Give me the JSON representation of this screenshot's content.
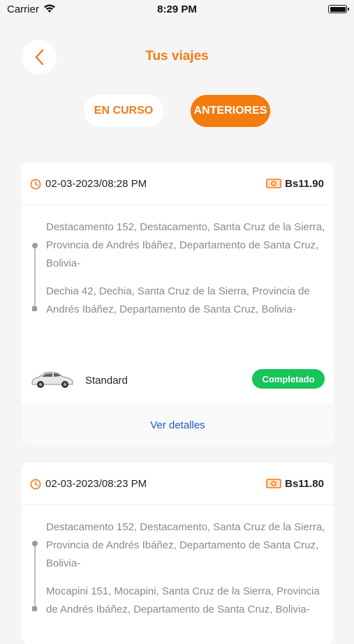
{
  "status_bar": {
    "carrier": "Carrier",
    "time": "8:29 PM"
  },
  "header": {
    "title": "Tus viajes"
  },
  "tabs": [
    {
      "label": "EN CURSO"
    },
    {
      "label": "ANTERIORES"
    }
  ],
  "trips": [
    {
      "datetime": "02-03-2023/08:28 PM",
      "price": "Bs11.90",
      "origin": "Destacamento 152, Destacamento, Santa Cruz de la Sierra, Provincia de Andrés Ibáñez, Departamento de Santa Cruz, Bolivia-",
      "destination": "Dechia 42, Dechia, Santa Cruz de la Sierra, Provincia de Andrés Ibáñez, Departamento de Santa Cruz, Bolivia-",
      "vehicle": "Standard",
      "status": "Completado",
      "details_label": "Ver detalles"
    },
    {
      "datetime": "02-03-2023/08:23 PM",
      "price": "Bs11.80",
      "origin": "Destacamento 152, Destacamento, Santa Cruz de la Sierra, Provincia de Andrés Ibáñez, Departamento de Santa Cruz, Bolivia-",
      "destination": "Mocapini 151, Mocapini, Santa Cruz de la Sierra, Provincia de Andrés Ibáñez, Departamento de Santa Cruz, Bolivia-"
    }
  ],
  "colors": {
    "accent": "#f47b0f",
    "success": "#16c45a",
    "link": "#1f5bbf"
  }
}
